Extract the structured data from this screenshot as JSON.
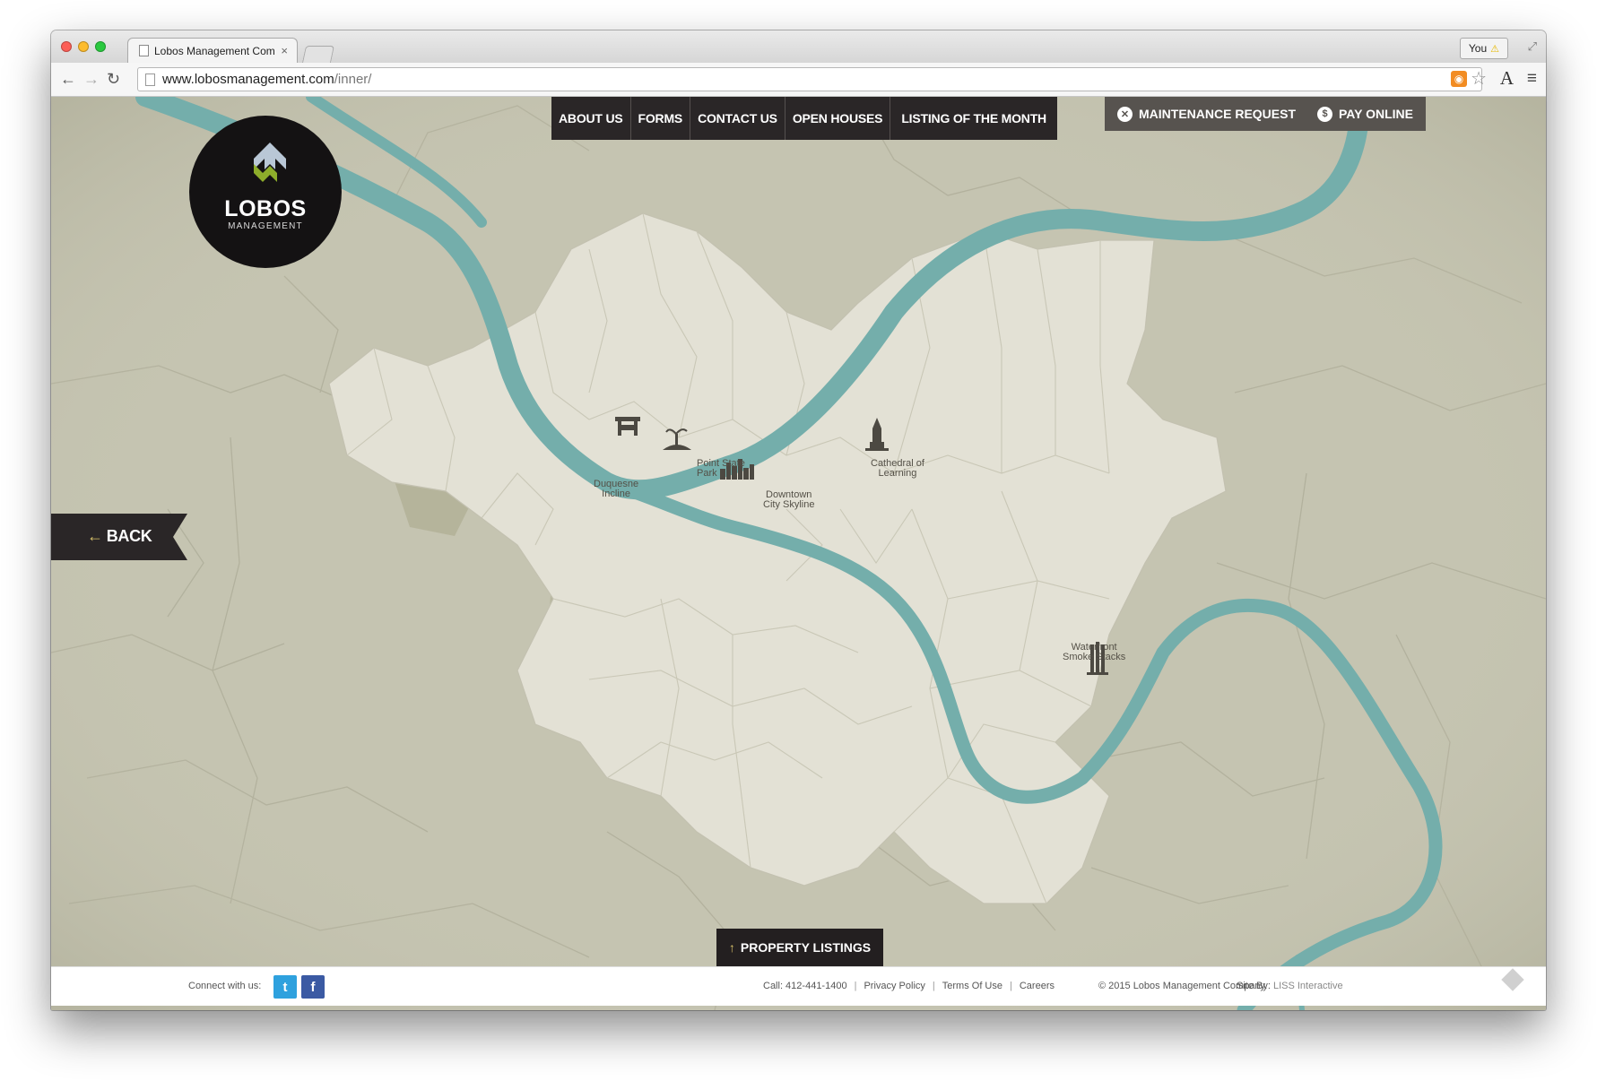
{
  "browser": {
    "tab_title": "Lobos Management Comp",
    "tab_close": "×",
    "user_button": "You",
    "url_domain": "www.lobosmanagement.com",
    "url_path": "/inner/"
  },
  "nav": {
    "items": [
      "ABOUT US",
      "FORMS",
      "CONTACT US",
      "OPEN HOUSES",
      "LISTING OF THE MONTH"
    ],
    "maintenance_label": "MAINTENANCE REQUEST",
    "pay_label": "PAY ONLINE"
  },
  "logo": {
    "name": "LOBOS",
    "sub": "MANAGEMENT"
  },
  "back_label": "BACK",
  "pois": {
    "incline": [
      "Duquesne",
      "Incline"
    ],
    "park": [
      "Point State",
      "Park"
    ],
    "skyline": [
      "Downtown",
      "City Skyline"
    ],
    "cathedral": [
      "Cathedral of",
      "Learning"
    ],
    "stacks": [
      "Waterfront",
      "Smoke Stacks"
    ]
  },
  "listings_label": "PROPERTY LISTINGS",
  "footer": {
    "connect": "Connect with us:",
    "call": "Call: 412-441-1400",
    "privacy": "Privacy Policy",
    "terms": "Terms Of Use",
    "careers": "Careers",
    "copyright": "© 2015 Lobos Management Company.",
    "site_by_label": "Site By:",
    "site_by_name": "LISS Interactive"
  },
  "colors": {
    "river": "#74aeab",
    "map_bg": "#c6c5b2",
    "city": "#e4e2d6",
    "nav_dark": "#2a2627",
    "accent": "#d9c26a",
    "logo_green": "#8dad2b"
  },
  "icons": [
    "rss-icon",
    "star-icon",
    "hamburger-icon",
    "wrench-icon",
    "dollar-icon",
    "twitter-icon",
    "facebook-icon",
    "arrow-left-icon",
    "arrow-up-icon"
  ]
}
